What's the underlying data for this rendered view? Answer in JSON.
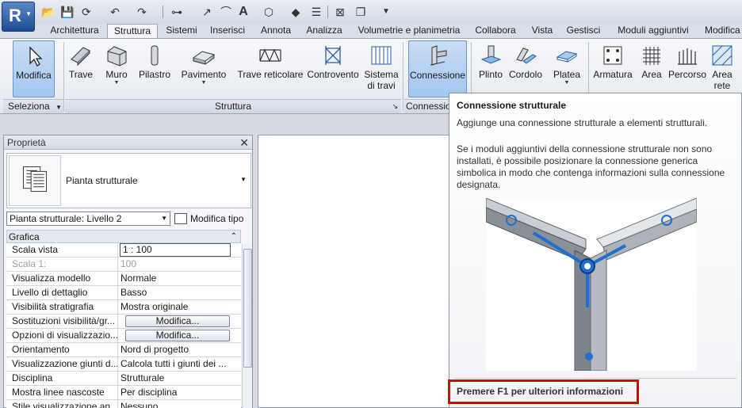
{
  "app": {
    "logo_letter": "R"
  },
  "tabs": [
    "Architettura",
    "Struttura",
    "Sistemi",
    "Inserisci",
    "Annota",
    "Analizza",
    "Volumetrie e planimetria",
    "Collabora",
    "Vista",
    "Gestisci",
    "Moduli aggiuntivi",
    "Modifica"
  ],
  "active_tab": "Struttura",
  "ribbon": {
    "modify_label": "Modifica",
    "select_panel": "Seleziona",
    "structure_panel": "Struttura",
    "connection_panel": "Connessio",
    "buttons": {
      "beam": "Trave",
      "wall": "Muro",
      "column": "Pilastro",
      "floor": "Pavimento",
      "truss": "Trave reticolare",
      "brace": "Controvento",
      "beam_system_1": "Sistema",
      "beam_system_2": "di travi",
      "connection": "Connessione",
      "footing": "Plinto",
      "curb": "Cordolo",
      "slab": "Platea",
      "rebar": "Armatura",
      "area": "Area",
      "path": "Percorso",
      "area_fabric_1": "Area",
      "area_fabric_2": "rete"
    }
  },
  "properties": {
    "title": "Proprietà",
    "type_name": "Pianta strutturale",
    "instance": "Pianta strutturale: Livello 2",
    "edit_type": "Modifica tipo",
    "group": "Grafica",
    "rows": [
      {
        "key": "Scala vista",
        "value": "1 : 100"
      },
      {
        "key": "Scala  1:",
        "value": "100"
      },
      {
        "key": "Visualizza modello",
        "value": "Normale"
      },
      {
        "key": "Livello di dettaglio",
        "value": "Basso"
      },
      {
        "key": "Visibilità stratigrafia",
        "value": "Mostra originale"
      },
      {
        "key": "Sostituzioni visibilità/gr...",
        "value": "Modifica..."
      },
      {
        "key": "Opzioni di visualizzazio...",
        "value": "Modifica..."
      },
      {
        "key": "Orientamento",
        "value": "Nord di progetto"
      },
      {
        "key": "Visualizzazione giunti d...",
        "value": "Calcola tutti i giunti dei ..."
      },
      {
        "key": "Disciplina",
        "value": "Strutturale"
      },
      {
        "key": "Mostra linee nascoste",
        "value": "Per disciplina"
      },
      {
        "key": "Stile visualizzazione an...",
        "value": "Nessuno"
      }
    ]
  },
  "tooltip": {
    "title": "Connessione strutturale",
    "description": "Aggiunge una connessione strutturale a elementi strutturali.",
    "long_description": "Se i moduli aggiuntivi della connessione strutturale non sono installati, è possibile posizionare la connessione generica simbolica in modo che contenga informazioni sulla connessione designata.",
    "help": "Premere F1 per ulteriori informazioni"
  },
  "colors": {
    "accent_pressed": "#a5c6ee",
    "highlight_box": "#e00000",
    "connection_blue": "#1f6fd1"
  }
}
